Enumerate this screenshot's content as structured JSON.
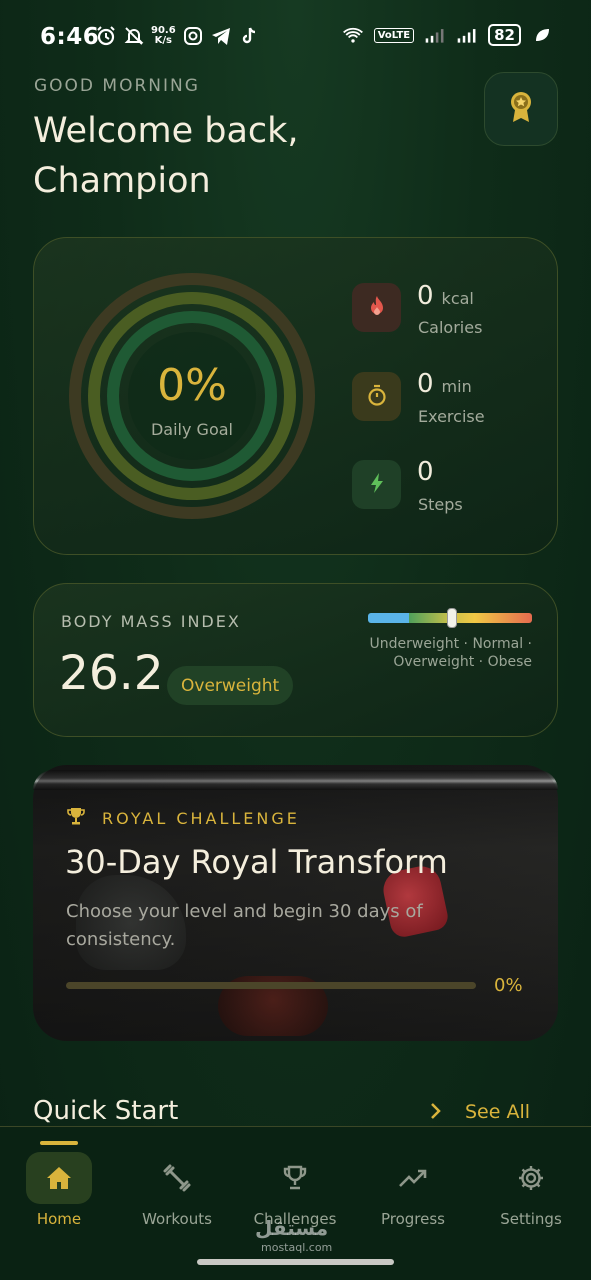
{
  "status_bar": {
    "time": "6:46",
    "net_speed_top": "90.6",
    "net_speed_bottom": "K/s",
    "volte": "VoLTE",
    "battery": "82"
  },
  "header": {
    "greeting": "GOOD MORNING",
    "welcome_line1": "Welcome back,",
    "welcome_line2": "Champion"
  },
  "daily": {
    "progress_pct": "0%",
    "progress_label": "Daily Goal",
    "progress_fraction": 0,
    "stats": [
      {
        "value": "0",
        "unit": "kcal",
        "label": "Calories",
        "icon": "fire-icon",
        "color": "#e2574c"
      },
      {
        "value": "0",
        "unit": "min",
        "label": "Exercise",
        "icon": "stopwatch-icon",
        "color": "#d9b43c"
      },
      {
        "value": "0",
        "unit": "",
        "label": "Steps",
        "icon": "bolt-icon",
        "color": "#5fbf5a"
      }
    ]
  },
  "bmi": {
    "title": "BODY MASS INDEX",
    "value": "26.2",
    "category": "Overweight",
    "legend_line1": "Underweight · Normal ·",
    "legend_line2": "Overweight · Obese"
  },
  "challenge": {
    "tag": "ROYAL CHALLENGE",
    "title": "30-Day Royal Transform",
    "description": "Choose your level and begin 30 days of consistency.",
    "progress_pct": "0%",
    "progress_fraction": 0
  },
  "quick_start": {
    "title": "Quick Start",
    "see_all": "See All"
  },
  "nav": [
    {
      "label": "Home",
      "icon": "home-icon",
      "active": true
    },
    {
      "label": "Workouts",
      "icon": "dumbbell-icon",
      "active": false
    },
    {
      "label": "Challenges",
      "icon": "trophy-icon",
      "active": false
    },
    {
      "label": "Progress",
      "icon": "trending-up-icon",
      "active": false
    },
    {
      "label": "Settings",
      "icon": "gear-icon",
      "active": false
    }
  ],
  "watermark": {
    "text": "مستقل",
    "sub": "mostaql.com"
  },
  "colors": {
    "accent_gold": "#d9b43c",
    "background": "#0f2c19"
  }
}
